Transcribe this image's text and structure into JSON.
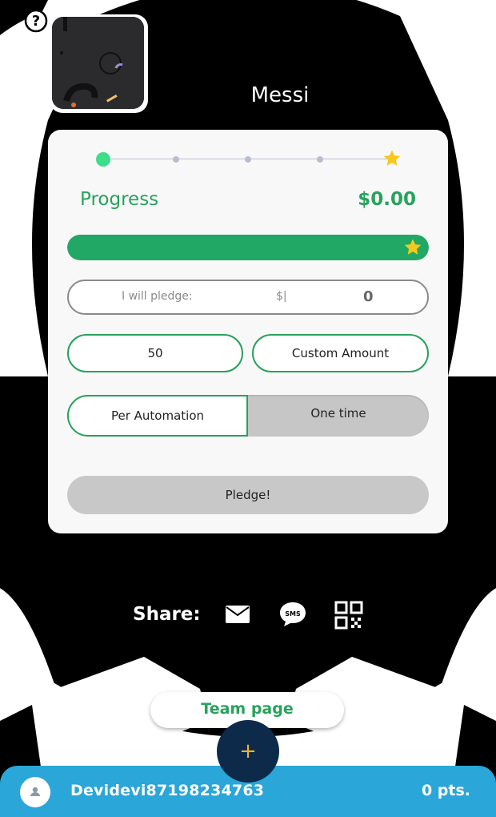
{
  "header": {
    "help_icon": "question-circle-icon",
    "player_name": "Messi"
  },
  "progress": {
    "label": "Progress",
    "amount": "$0.00",
    "fraction": 1.0,
    "steps": 5,
    "goal_icon": "star-icon"
  },
  "pledge": {
    "label": "I will pledge:",
    "currency": "$|",
    "value": "0"
  },
  "amounts": {
    "preset": "50",
    "custom": "Custom Amount"
  },
  "frequency": {
    "selected": "Per Automation",
    "other": "One time"
  },
  "submit_label": "Pledge!",
  "share": {
    "label": "Share:",
    "icons": [
      "email-icon",
      "sms-icon",
      "qr-code-icon"
    ]
  },
  "team_page_label": "Team page",
  "fab_label": "+",
  "footer": {
    "username": "Devidevi87198234763",
    "points": "0 pts."
  },
  "colors": {
    "accent_green": "#27a25c",
    "progress_fill": "#21a864",
    "footer_blue": "#2aa6d9",
    "fab_navy": "#0d2a4a",
    "star_yellow": "#f8c91c"
  }
}
